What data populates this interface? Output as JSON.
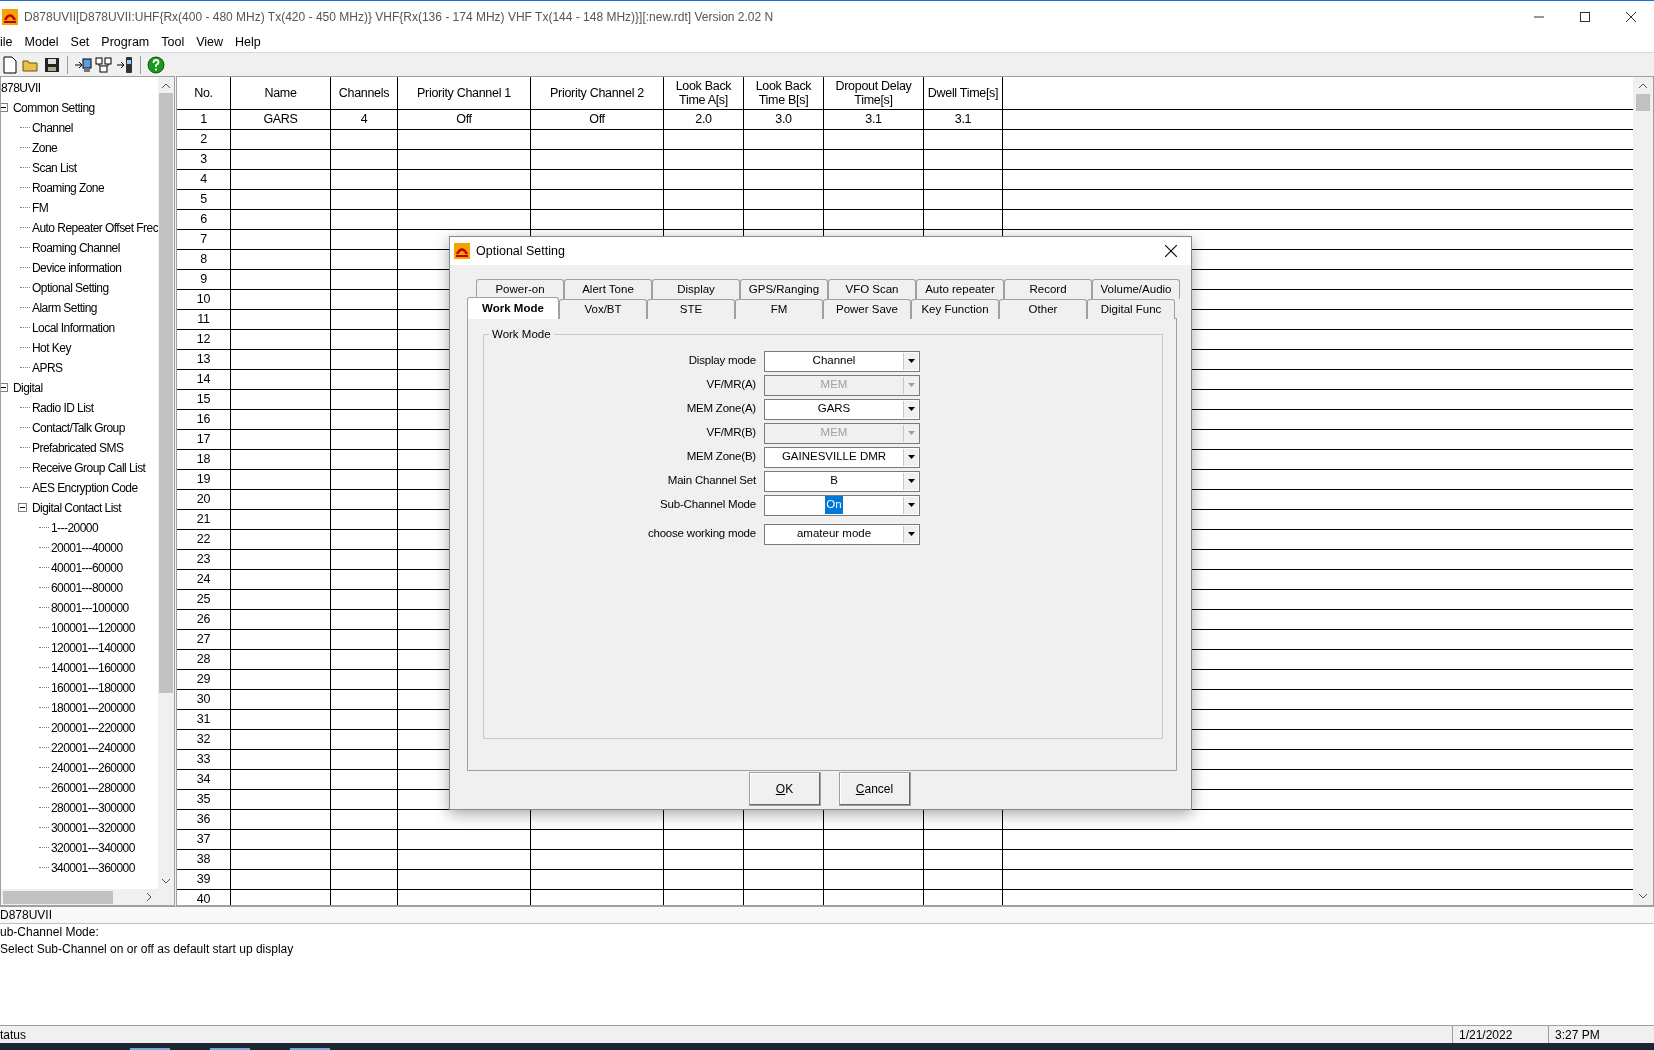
{
  "window": {
    "title": "D878UVII[D878UVII:UHF{Rx(400 - 480 MHz) Tx(420 - 450 MHz)} VHF{Rx(136 - 174 MHz) VHF Tx(144 - 148 MHz)}][:new.rdt] Version 2.02 N"
  },
  "menu": [
    "ile",
    "Model",
    "Set",
    "Program",
    "Tool",
    "View",
    "Help"
  ],
  "tree": {
    "label": "878UVII",
    "children": [
      {
        "label": "Common Setting",
        "expanded": true,
        "children": [
          {
            "label": "Channel"
          },
          {
            "label": "Zone"
          },
          {
            "label": "Scan List"
          },
          {
            "label": "Roaming Zone"
          },
          {
            "label": "FM"
          },
          {
            "label": "Auto Repeater Offset Frec"
          },
          {
            "label": "Roaming Channel"
          },
          {
            "label": "Device information"
          },
          {
            "label": "Optional Setting"
          },
          {
            "label": "Alarm Setting"
          },
          {
            "label": "Local Information"
          },
          {
            "label": "Hot Key"
          },
          {
            "label": "APRS"
          }
        ]
      },
      {
        "label": "Digital",
        "expanded": true,
        "children": [
          {
            "label": "Radio ID List"
          },
          {
            "label": "Contact/Talk Group"
          },
          {
            "label": "Prefabricated SMS"
          },
          {
            "label": "Receive Group Call List"
          },
          {
            "label": "AES Encryption Code"
          },
          {
            "label": "Digital Contact List",
            "expanded": true,
            "children": [
              {
                "label": "1---20000"
              },
              {
                "label": "20001---40000"
              },
              {
                "label": "40001---60000"
              },
              {
                "label": "60001---80000"
              },
              {
                "label": "80001---100000"
              },
              {
                "label": "100001---120000"
              },
              {
                "label": "120001---140000"
              },
              {
                "label": "140001---160000"
              },
              {
                "label": "160001---180000"
              },
              {
                "label": "180001---200000"
              },
              {
                "label": "200001---220000"
              },
              {
                "label": "220001---240000"
              },
              {
                "label": "240001---260000"
              },
              {
                "label": "260001---280000"
              },
              {
                "label": "280001---300000"
              },
              {
                "label": "300001---320000"
              },
              {
                "label": "320001---340000"
              },
              {
                "label": "340001---360000"
              }
            ]
          }
        ]
      }
    ]
  },
  "table": {
    "columns": [
      "No.",
      "Name",
      "Channels",
      "Priority Channel 1",
      "Priority Channel 2",
      "Look Back Time A[s]",
      "Look Back Time B[s]",
      "Dropout Delay Time[s]",
      "Dwell Time[s]"
    ],
    "rows": [
      [
        "1",
        "GARS",
        "4",
        "Off",
        "Off",
        "2.0",
        "3.0",
        "3.1",
        "3.1"
      ],
      [
        "2"
      ],
      [
        "3"
      ],
      [
        "4"
      ],
      [
        "5"
      ],
      [
        "6"
      ],
      [
        "7"
      ],
      [
        "8"
      ],
      [
        "9"
      ],
      [
        "10"
      ],
      [
        "11"
      ],
      [
        "12"
      ],
      [
        "13"
      ],
      [
        "14"
      ],
      [
        "15"
      ],
      [
        "16"
      ],
      [
        "17"
      ],
      [
        "18"
      ],
      [
        "19"
      ],
      [
        "20"
      ],
      [
        "21"
      ],
      [
        "22"
      ],
      [
        "23"
      ],
      [
        "24"
      ],
      [
        "25"
      ],
      [
        "26"
      ],
      [
        "27"
      ],
      [
        "28"
      ],
      [
        "29"
      ],
      [
        "30"
      ],
      [
        "31"
      ],
      [
        "32"
      ],
      [
        "33"
      ],
      [
        "34"
      ],
      [
        "35"
      ],
      [
        "36"
      ],
      [
        "37"
      ],
      [
        "38"
      ],
      [
        "39"
      ],
      [
        "40"
      ]
    ]
  },
  "dialog": {
    "title": "Optional Setting",
    "tab_rows": [
      [
        {
          "label": "Power-on",
          "selected": false
        },
        {
          "label": "Alert Tone",
          "selected": false
        },
        {
          "label": "Display",
          "selected": false
        },
        {
          "label": "GPS/Ranging",
          "selected": false
        },
        {
          "label": "VFO Scan",
          "selected": false
        },
        {
          "label": "Auto repeater",
          "selected": false
        },
        {
          "label": "Record",
          "selected": false
        },
        {
          "label": "Volume/Audio",
          "selected": false
        }
      ],
      [
        {
          "label": "Work Mode",
          "selected": true
        },
        {
          "label": "Vox/BT",
          "selected": false
        },
        {
          "label": "STE",
          "selected": false
        },
        {
          "label": "FM",
          "selected": false
        },
        {
          "label": "Power Save",
          "selected": false
        },
        {
          "label": "Key Function",
          "selected": false
        },
        {
          "label": "Other",
          "selected": false
        },
        {
          "label": "Digital Func",
          "selected": false
        }
      ]
    ],
    "group": {
      "title": "Work Mode",
      "fields": [
        {
          "label": "Display mode",
          "value": "Channel",
          "disabled": false,
          "text_selected": false
        },
        {
          "label": "VF/MR(A)",
          "value": "MEM",
          "disabled": true,
          "text_selected": false
        },
        {
          "label": "MEM Zone(A)",
          "value": "GARS",
          "disabled": false,
          "text_selected": false
        },
        {
          "label": "VF/MR(B)",
          "value": "MEM",
          "disabled": true,
          "text_selected": false
        },
        {
          "label": "MEM Zone(B)",
          "value": "GAINESVILLE DMR",
          "disabled": false,
          "text_selected": false
        },
        {
          "label": "Main Channel Set",
          "value": "B",
          "disabled": false,
          "text_selected": false
        },
        {
          "label": "Sub-Channel Mode",
          "value": "On",
          "disabled": false,
          "text_selected": true
        },
        {
          "label": "choose working mode",
          "value": "amateur mode",
          "disabled": false,
          "text_selected": false
        }
      ]
    },
    "buttons": [
      {
        "label": "OK",
        "underline_first": true
      },
      {
        "label": "Cancel",
        "underline_first": true
      }
    ]
  },
  "info": {
    "title": "D878UVII",
    "lines": [
      "ub-Channel Mode:",
      "Select Sub-Channel on or off as default start up display"
    ]
  },
  "status_bar": {
    "text": "tatus",
    "date": "1/21/2022",
    "time": "3:27 PM"
  }
}
